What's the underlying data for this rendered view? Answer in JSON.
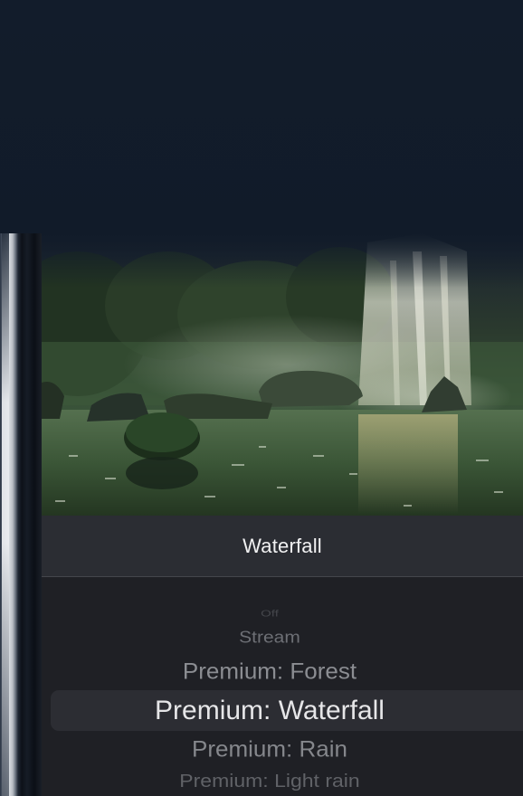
{
  "sound_title": "Waterfall",
  "hero_image": {
    "icon": "waterfall-scene-image"
  },
  "picker": {
    "selected_index": 3,
    "options": [
      "Off",
      "Stream",
      "Premium: Forest",
      "Premium: Waterfall",
      "Premium: Rain",
      "Premium: Light rain"
    ]
  },
  "colors": {
    "background": "#111b29",
    "title_bar": "#2b2d33",
    "picker_bg": "#1f2025",
    "selected_row": "#2c2d33",
    "selected_text": "#e6e6e8"
  }
}
